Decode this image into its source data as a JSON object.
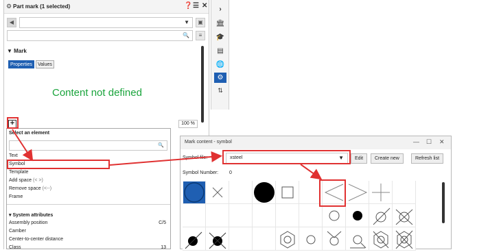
{
  "left_panel": {
    "title": "Part mark (1 selected)",
    "header_icons": [
      "gear-icon",
      "help-icon",
      "list-options-icon",
      "close-icon",
      "chevron-right-icon"
    ],
    "section_title": "Mark",
    "tabs": [
      "Properties",
      "Values"
    ],
    "empty_message": "Content not defined",
    "add_button": "+",
    "zoom": "100 %"
  },
  "select_element": {
    "title": "Select an element",
    "search_value": "",
    "items": [
      "Text",
      "Symbol",
      "Template"
    ],
    "add_space": "Add space",
    "add_space_hint": "(< >)",
    "remove_space": "Remove space",
    "remove_space_hint": "(<--)",
    "frame": "Frame",
    "group_title": "System attributes",
    "attributes": [
      {
        "name": "Assembly position",
        "value": "C/5"
      },
      {
        "name": "Camber",
        "value": ""
      },
      {
        "name": "Center-to-center distance",
        "value": ""
      },
      {
        "name": "Class",
        "value": "13"
      }
    ]
  },
  "right_toolbar": {
    "icons": [
      "chevron-right-icon",
      "bank-icon",
      "hat-icon",
      "window-icon",
      "globe-icon",
      "gear-icon",
      "sort-icon"
    ],
    "active_index": 5
  },
  "dialog": {
    "title": "Mark content - symbol",
    "window_controls": [
      "—",
      "☐",
      "✕"
    ],
    "symbol_file_label": "Symbol file:",
    "symbol_file_value": "xsteel",
    "edit_label": "Edit",
    "create_new_label": "Create new",
    "refresh_label": "Refresh list",
    "symbol_number_label": "Symbol Number:",
    "symbol_number_value": "0"
  },
  "colors": {
    "accent": "#1f5fb2",
    "highlight": "#e03131",
    "message": "#1aa43c"
  }
}
